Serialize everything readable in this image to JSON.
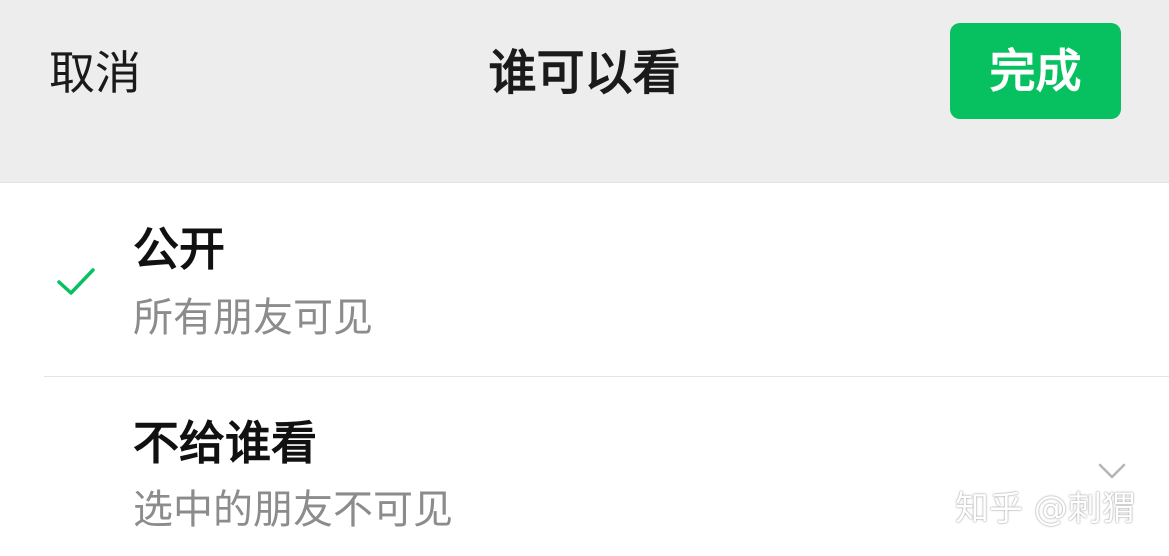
{
  "header": {
    "cancel_label": "取消",
    "title": "谁可以看",
    "done_label": "完成"
  },
  "options": [
    {
      "title": "公开",
      "subtitle": "所有朋友可见",
      "selected": true,
      "icon": "check-icon"
    },
    {
      "title": "不给谁看",
      "subtitle": "选中的朋友不可见",
      "selected": false,
      "icon": "chevron-down-icon"
    }
  ],
  "watermark": "知乎 @刺猬",
  "colors": {
    "accent": "#07c160",
    "header_bg": "#ededed",
    "subtitle": "#8c8c8c"
  }
}
